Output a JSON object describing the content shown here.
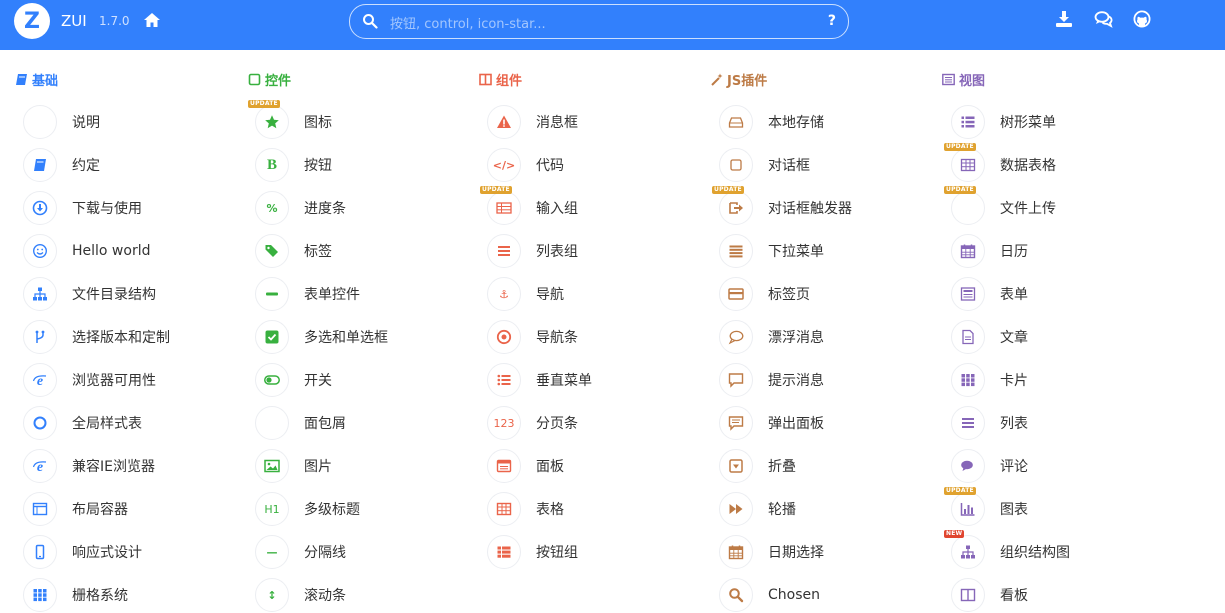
{
  "header": {
    "logo_letter": "Z",
    "brand": "ZUI",
    "version": "1.7.0",
    "search_placeholder": "按钮, control, icon-star...",
    "help_glyph": "?",
    "icons": [
      "home-icon",
      "search-icon",
      "download-icon",
      "chat-icon",
      "github-icon"
    ]
  },
  "colors": {
    "header_bg": "#3280fc",
    "basic": "#3280fc",
    "controls": "#38b03f",
    "components": "#ea644a",
    "plugins": "#bd7b46",
    "views": "#8666b8"
  },
  "columns": [
    {
      "title": "基础",
      "items": [
        {
          "label": "说明",
          "icon": "heart-icon"
        },
        {
          "label": "约定",
          "icon": "book-icon"
        },
        {
          "label": "下载与使用",
          "icon": "download-circle-icon"
        },
        {
          "label": "Hello world",
          "icon": "smile-icon"
        },
        {
          "label": "文件目录结构",
          "icon": "sitemap-icon"
        },
        {
          "label": "选择版本和定制",
          "icon": "branch-icon"
        },
        {
          "label": "浏览器可用性",
          "icon": "ie-icon"
        },
        {
          "label": "全局样式表",
          "icon": "circle-icon"
        },
        {
          "label": "兼容IE浏览器",
          "icon": "ie-icon"
        },
        {
          "label": "布局容器",
          "icon": "window-icon"
        },
        {
          "label": "响应式设计",
          "icon": "mobile-icon"
        },
        {
          "label": "栅格系统",
          "icon": "grid-icon"
        }
      ]
    },
    {
      "title": "控件",
      "items": [
        {
          "label": "图标",
          "icon": "star-icon",
          "tag": "UPDATE"
        },
        {
          "label": "按钮",
          "icon": "bold-icon",
          "glyph": "B"
        },
        {
          "label": "进度条",
          "icon": "percent-icon",
          "glyph": "%"
        },
        {
          "label": "标签",
          "icon": "tags-icon"
        },
        {
          "label": "表单控件",
          "icon": "minus-icon"
        },
        {
          "label": "多选和单选框",
          "icon": "checkbox-icon"
        },
        {
          "label": "开关",
          "icon": "toggle-icon"
        },
        {
          "label": "面包屑",
          "icon": "location-icon"
        },
        {
          "label": "图片",
          "icon": "picture-icon"
        },
        {
          "label": "多级标题",
          "icon": "header-icon",
          "glyph": "H1"
        },
        {
          "label": "分隔线",
          "icon": "divider-icon",
          "glyph": "—"
        },
        {
          "label": "滚动条",
          "icon": "arrows-v-icon",
          "glyph": "↕"
        }
      ]
    },
    {
      "title": "组件",
      "items": [
        {
          "label": "消息框",
          "icon": "warning-icon"
        },
        {
          "label": "代码",
          "icon": "code-icon",
          "glyph": "</>"
        },
        {
          "label": "输入组",
          "icon": "input-group-icon",
          "tag": "UPDATE"
        },
        {
          "label": "列表组",
          "icon": "list-icon"
        },
        {
          "label": "导航",
          "icon": "anchor-icon",
          "glyph": "⚓"
        },
        {
          "label": "导航条",
          "icon": "target-icon"
        },
        {
          "label": "垂直菜单",
          "icon": "list-ul-icon"
        },
        {
          "label": "分页条",
          "icon": "pager-icon",
          "glyph": "123"
        },
        {
          "label": "面板",
          "icon": "panel-icon"
        },
        {
          "label": "表格",
          "icon": "table-icon"
        },
        {
          "label": "按钮组",
          "icon": "th-list-icon"
        }
      ]
    },
    {
      "title": "JS插件",
      "items": [
        {
          "label": "本地存储",
          "icon": "hdd-icon"
        },
        {
          "label": "对话框",
          "icon": "square-icon"
        },
        {
          "label": "对话框触发器",
          "icon": "external-icon",
          "tag": "UPDATE"
        },
        {
          "label": "下拉菜单",
          "icon": "bars-icon"
        },
        {
          "label": "标签页",
          "icon": "credit-card-icon"
        },
        {
          "label": "漂浮消息",
          "icon": "comment-icon"
        },
        {
          "label": "提示消息",
          "icon": "comment-square-icon"
        },
        {
          "label": "弹出面板",
          "icon": "comment-text-icon"
        },
        {
          "label": "折叠",
          "icon": "collapse-icon"
        },
        {
          "label": "轮播",
          "icon": "forward-icon"
        },
        {
          "label": "日期选择",
          "icon": "calendar-icon"
        },
        {
          "label": "Chosen",
          "icon": "search-icon"
        }
      ]
    },
    {
      "title": "视图",
      "items": [
        {
          "label": "树形菜单",
          "icon": "tree-list-icon"
        },
        {
          "label": "数据表格",
          "icon": "datatable-icon",
          "tag": "UPDATE"
        },
        {
          "label": "文件上传",
          "icon": "cloud-upload-icon",
          "tag": "UPDATE"
        },
        {
          "label": "日历",
          "icon": "calendar-icon"
        },
        {
          "label": "表单",
          "icon": "form-icon"
        },
        {
          "label": "文章",
          "icon": "file-icon"
        },
        {
          "label": "卡片",
          "icon": "th-icon"
        },
        {
          "label": "列表",
          "icon": "list-icon"
        },
        {
          "label": "评论",
          "icon": "comments-icon"
        },
        {
          "label": "图表",
          "icon": "bar-chart-icon",
          "tag": "UPDATE"
        },
        {
          "label": "组织结构图",
          "icon": "org-chart-icon",
          "tag": "NEW"
        },
        {
          "label": "看板",
          "icon": "kanban-icon"
        }
      ]
    }
  ]
}
